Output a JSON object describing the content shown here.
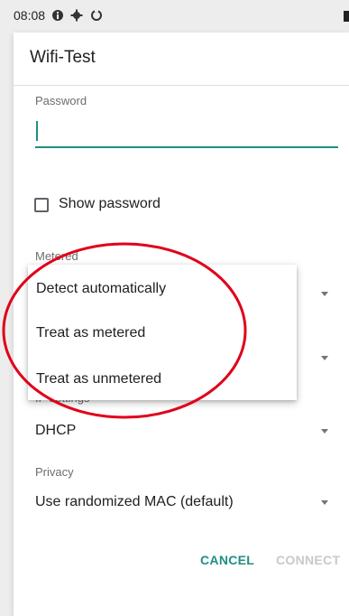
{
  "status_bar": {
    "time": "08:08",
    "icons": [
      "info-circle-icon",
      "gear-icon",
      "sync-icon",
      "battery-icon"
    ]
  },
  "dialog": {
    "title": "Wifi-Test",
    "password": {
      "label": "Password",
      "value": ""
    },
    "show_password": {
      "label": "Show password",
      "checked": false
    },
    "metered": {
      "label": "Metered",
      "menu_options": [
        "Detect automatically",
        "Treat as metered",
        "Treat as unmetered"
      ]
    },
    "ip_settings": {
      "label": "IP settings",
      "value": "DHCP"
    },
    "privacy": {
      "label": "Privacy",
      "value": "Use randomized MAC (default)"
    },
    "buttons": {
      "cancel": "CANCEL",
      "connect": "CONNECT"
    }
  },
  "colors": {
    "accent": "#1f8f83",
    "annotation": "#e0001a",
    "disabled": "#c9c9c9"
  }
}
